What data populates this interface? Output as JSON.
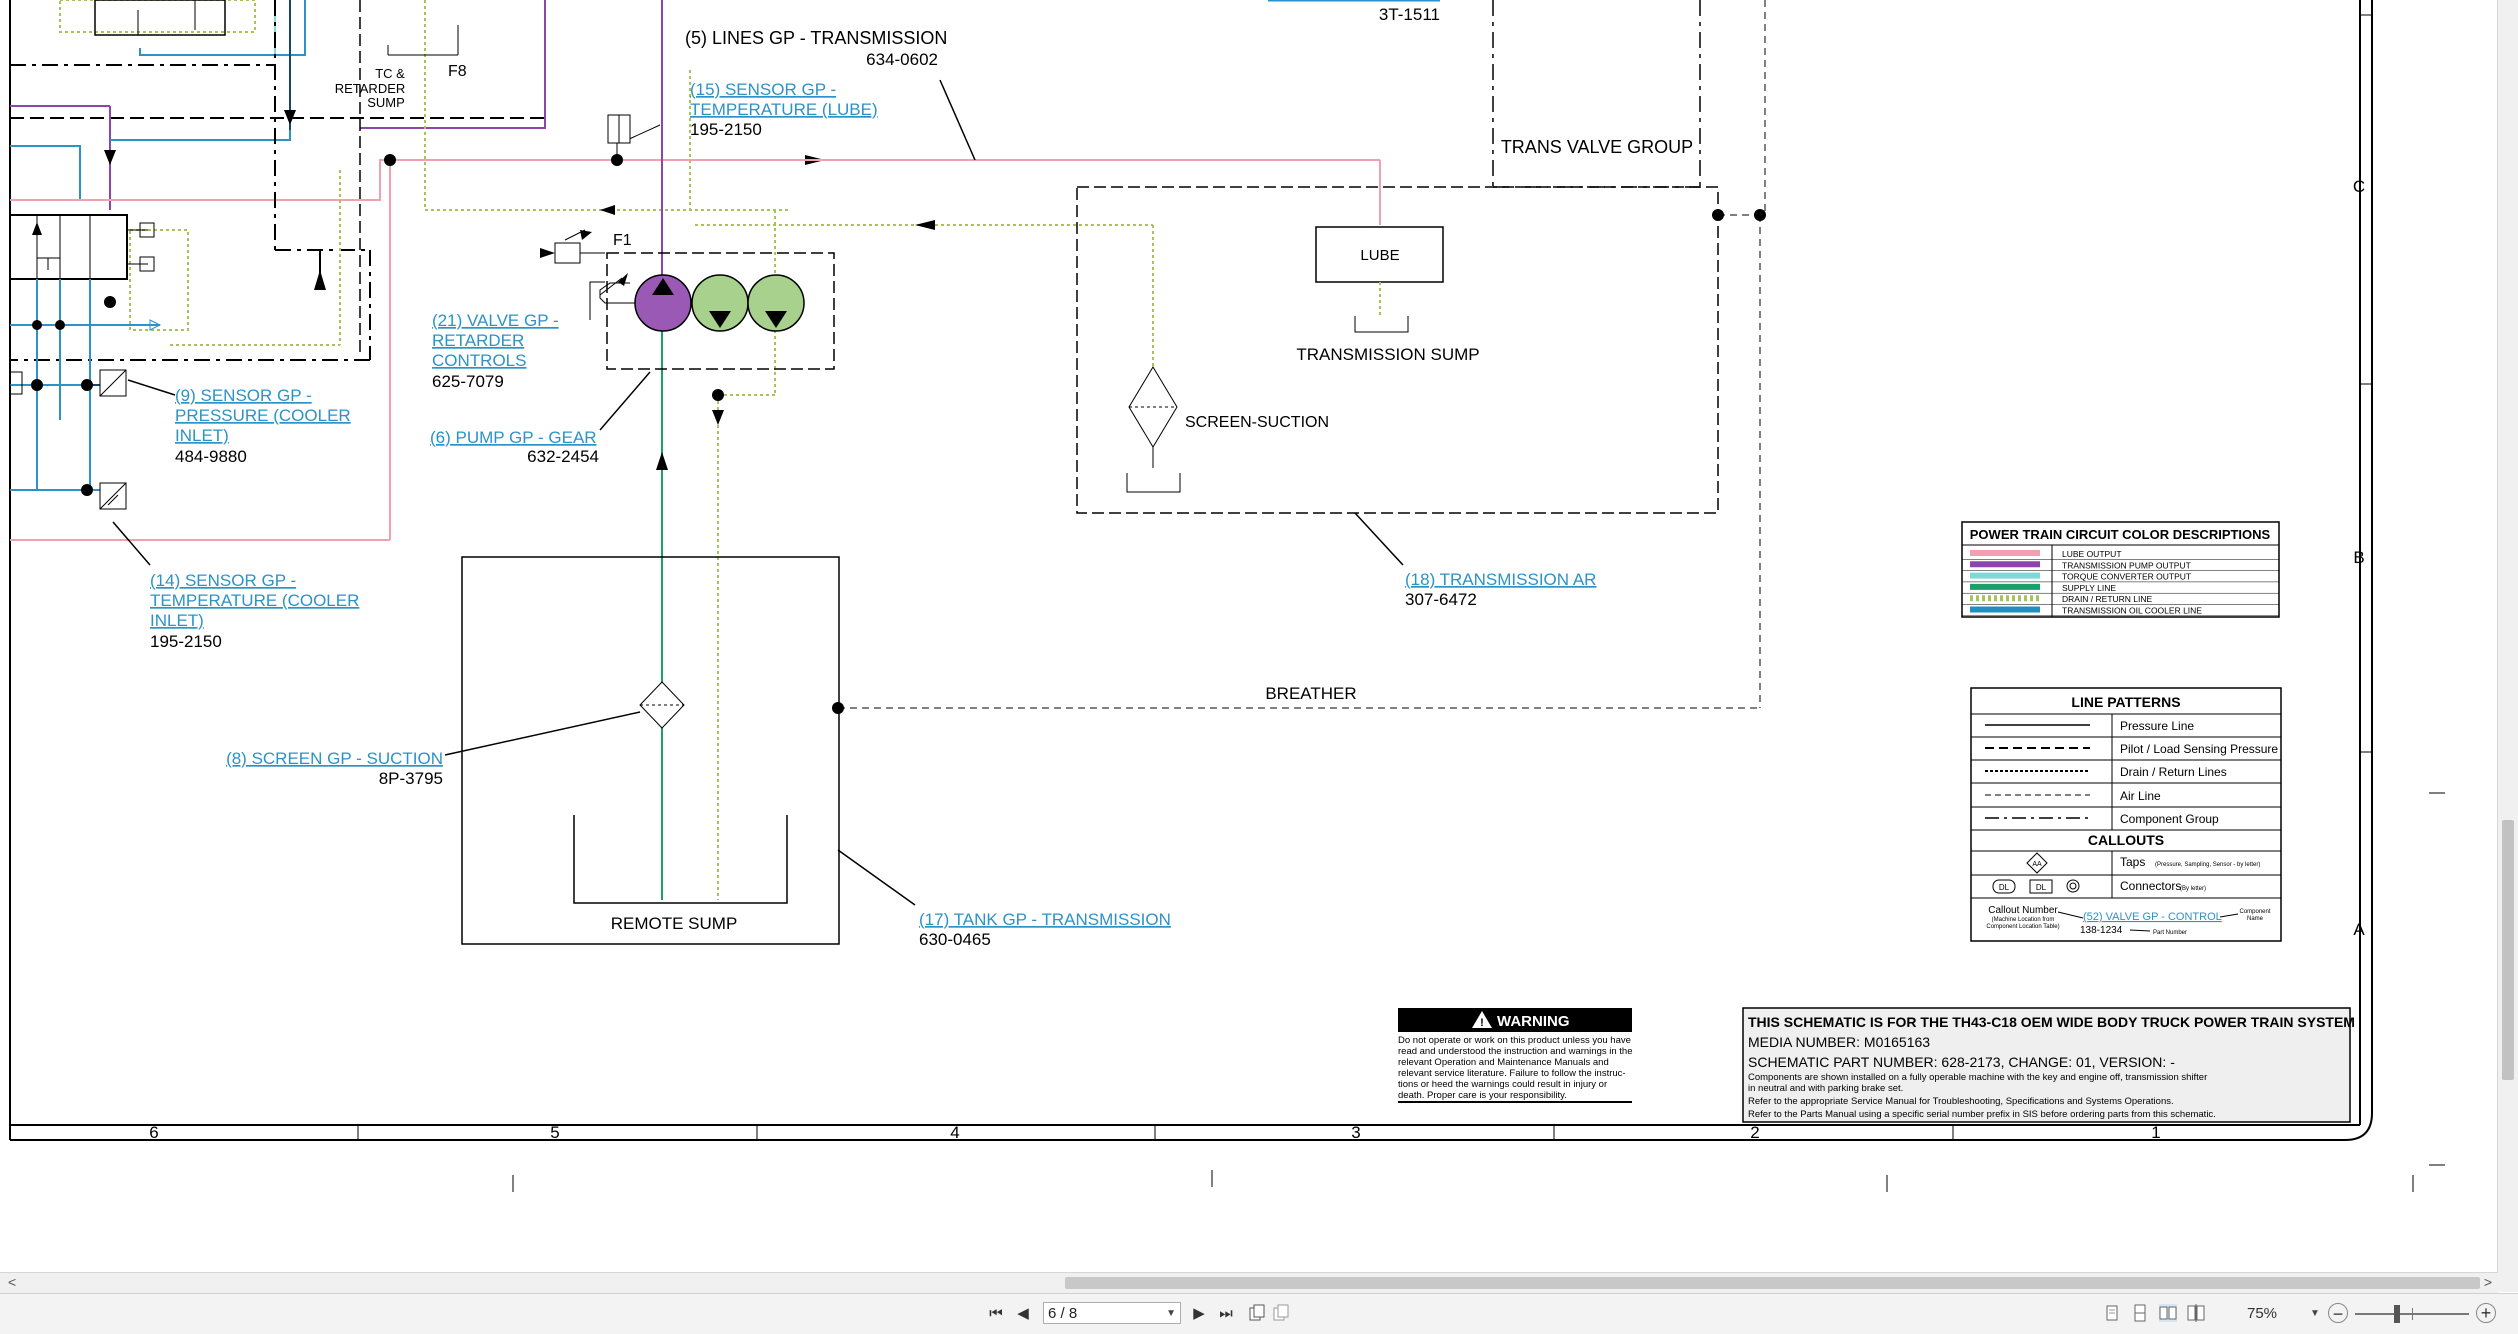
{
  "document": {
    "callouts": {
      "c5": {
        "title": "(5) LINES GP - TRANSMISSION",
        "part": "634-0602"
      },
      "c15": {
        "l1": "(15) SENSOR GP -",
        "l2": "TEMPERATURE (LUBE)",
        "part": "195-2150"
      },
      "c21": {
        "l1": "(21) VALVE GP -",
        "l2": "RETARDER",
        "l3": "CONTROLS",
        "part": "625-7079"
      },
      "c9": {
        "l1": "(9) SENSOR GP -",
        "l2": "PRESSURE (COOLER",
        "l3": "INLET)",
        "part": "484-9880"
      },
      "c6": {
        "title": "(6) PUMP GP - GEAR",
        "part": "632-2454"
      },
      "c14": {
        "l1": "(14) SENSOR GP -",
        "l2": "TEMPERATURE (COOLER",
        "l3": "INLET)",
        "part": "195-2150"
      },
      "c8": {
        "title": "(8) SCREEN GP - SUCTION",
        "part": "8P-3795"
      },
      "c17": {
        "title": "(17) TANK GP - TRANSMISSION",
        "part": "630-0465"
      },
      "c18": {
        "title": "(18) TRANSMISSION AR",
        "part": "307-6472"
      },
      "top_part": "3T-1511"
    },
    "labels": {
      "tc_sump_1": "TC &",
      "tc_sump_2": "RETARDER",
      "tc_sump_3": "SUMP",
      "f8": "F8",
      "f1": "F1",
      "trans_valve_group": "TRANS VALVE GROUP",
      "lube": "LUBE",
      "transmission_sump": "TRANSMISSION SUMP",
      "screen_suction": "SCREEN-SUCTION",
      "breather": "BREATHER",
      "remote_sump": "REMOTE SUMP"
    },
    "grid": {
      "columns": [
        "6",
        "5",
        "4",
        "3",
        "2",
        "1"
      ],
      "rows": [
        "C",
        "B",
        "A"
      ]
    },
    "color_legend": {
      "title": "POWER TRAIN CIRCUIT COLOR DESCRIPTIONS",
      "items": [
        {
          "label": "LUBE OUTPUT",
          "color": "#f0a0b0"
        },
        {
          "label": "TRANSMISSION PUMP OUTPUT",
          "color": "#8e44ad"
        },
        {
          "label": "TORQUE CONVERTER OUTPUT",
          "color": "#7fd8d8"
        },
        {
          "label": "SUPPLY LINE",
          "color": "#1aa06a"
        },
        {
          "label": "DRAIN / RETURN LINE",
          "color": "#a6c45a"
        },
        {
          "label": "TRANSMISSION OIL COOLER LINE",
          "color": "#1f8fc0"
        }
      ]
    },
    "line_patterns": {
      "title": "LINE PATTERNS",
      "items": [
        "Pressure Line",
        "Pilot / Load Sensing Pressure",
        "Drain / Return Lines",
        "Air Line",
        "Component Group"
      ],
      "callouts_title": "CALLOUTS",
      "taps_label": "Taps",
      "taps_note": "(Pressure, Sampling, Sensor - by letter)",
      "connectors_label": "Connectors",
      "connectors_note": "(By letter)",
      "tap_letter": "AA",
      "conn1": "DL",
      "conn2": "DL",
      "example_callout_number": "Callout Number",
      "example_callout_note1": "(Machine Location from",
      "example_callout_note2": "Component Location Table)",
      "example_link": "(52) VALVE GP - CONTROL",
      "example_component_name1": "Component",
      "example_component_name2": "Name",
      "example_part": "138-1234",
      "example_part_number": "Part Number"
    },
    "warning": {
      "title": "WARNING",
      "lines": [
        "Do not operate or work on this product unless you have",
        "read and understood the instruction and warnings in the",
        "relevant Operation and Maintenance Manuals and",
        "relevant service literature. Failure to follow the instruc-",
        "tions or heed the warnings could result in injury or",
        "death. Proper care is your responsibility."
      ]
    },
    "title_block": {
      "title": "THIS SCHEMATIC IS FOR THE TH43-C18 OEM WIDE BODY TRUCK POWER TRAIN SYSTEM",
      "media": "MEDIA NUMBER: M0165163",
      "part": "SCHEMATIC PART NUMBER: 628-2173, CHANGE: 01, VERSION: -",
      "note1": "Components are shown installed on a fully operable machine with the key and engine off, transmission shifter",
      "note2": "in neutral and with parking brake set.",
      "note3": "Refer to the appropriate Service Manual for Troubleshooting, Specifications and Systems Operations.",
      "note4": "Refer to the Parts Manual using a specific serial number prefix in SIS before ordering parts from this schematic."
    }
  },
  "statusbar": {
    "page_value": "6 / 8",
    "zoom": "75%",
    "zoom_out": "−",
    "zoom_in": "+",
    "nav": {
      "first": "⏮",
      "prev": "◀",
      "next": "▶",
      "last": "⏭"
    }
  }
}
